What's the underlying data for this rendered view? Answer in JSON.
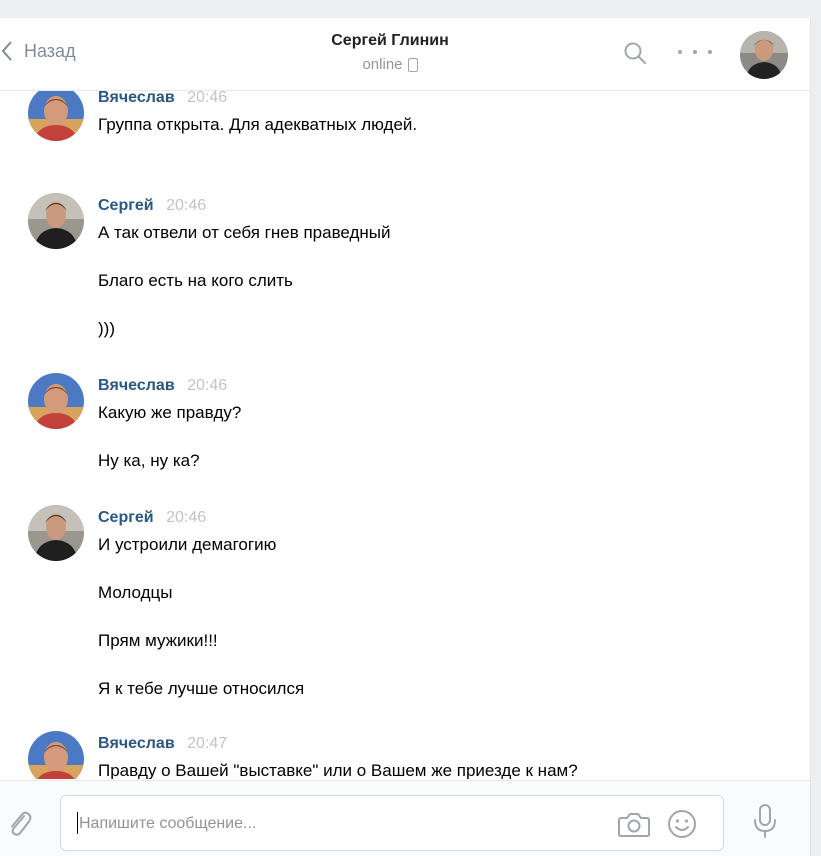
{
  "header": {
    "back_label": "Назад",
    "title": "Сергей Глинин",
    "status": "online"
  },
  "messages": [
    {
      "sender": "Вячеслав",
      "time": "20:46",
      "avatar": "slava-avatar",
      "lines": [
        "Группа открыта. Для адекватных людей."
      ]
    },
    {
      "sender": "Сергей",
      "time": "20:46",
      "avatar": "sergey-avatar",
      "lines": [
        "А так отвели от себя гнев праведный",
        "Благо есть на кого слить",
        ")))"
      ]
    },
    {
      "sender": "Вячеслав",
      "time": "20:46",
      "avatar": "slava-avatar",
      "lines": [
        "Какую же правду?",
        "Ну ка, ну ка?"
      ]
    },
    {
      "sender": "Сергей",
      "time": "20:46",
      "avatar": "sergey-avatar",
      "lines": [
        "И устроили демагогию",
        "Молодцы",
        "Прям мужики!!!",
        "Я к тебе лучше относился"
      ]
    },
    {
      "sender": "Вячеслав",
      "time": "20:47",
      "avatar": "slava-avatar",
      "lines": [
        "Правду о Вашей \"выставке\" или о Вашем же приезде к нам?"
      ]
    }
  ],
  "composer": {
    "placeholder": "Напишите сообщение...",
    "value": ""
  },
  "icons": {
    "back": "chevron-left-icon",
    "search": "search-icon",
    "more": "more-dots-icon",
    "attach": "paperclip-icon",
    "camera": "camera-icon",
    "emoji": "smile-icon",
    "voice": "microphone-icon"
  },
  "colors": {
    "sender": "#2a5885",
    "time": "#c0c4ca",
    "icon": "#a0a6ae",
    "background": "#edeef0"
  }
}
